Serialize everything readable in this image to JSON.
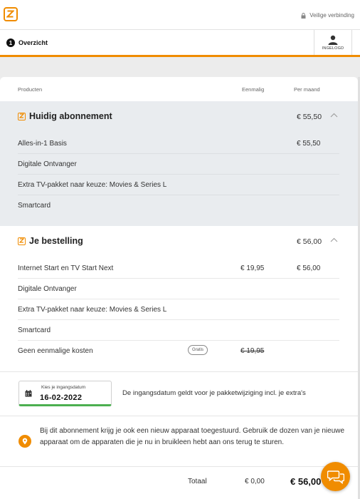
{
  "header": {
    "secure_label": "Veilige verbinding",
    "step_number": "1",
    "step_label": "Overzicht",
    "login_label": "INGELOGD"
  },
  "columns": {
    "products": "Producten",
    "once": "Eenmalig",
    "monthly": "Per maand"
  },
  "current": {
    "title": "Huidig abonnement",
    "price": "€ 55,50",
    "items": [
      {
        "name": "Alles-in-1 Basis",
        "once": "",
        "month": "€ 55,50"
      },
      {
        "name": "Digitale Ontvanger",
        "once": "",
        "month": ""
      },
      {
        "name": "Extra TV-pakket naar keuze: Movies & Series L",
        "once": "",
        "month": ""
      },
      {
        "name": "Smartcard",
        "once": "",
        "month": ""
      }
    ]
  },
  "order": {
    "title": "Je bestelling",
    "price": "€ 56,00",
    "items": [
      {
        "name": "Internet Start en TV Start Next",
        "once": "€ 19,95",
        "month": "€ 56,00"
      },
      {
        "name": "Digitale Ontvanger",
        "once": "",
        "month": ""
      },
      {
        "name": "Extra TV-pakket naar keuze: Movies & Series L",
        "once": "",
        "month": ""
      },
      {
        "name": "Smartcard",
        "once": "",
        "month": ""
      }
    ],
    "no_costs": {
      "name": "Geen eenmalige kosten",
      "badge": "Gratis",
      "struck": "€ 19,95"
    }
  },
  "start_date": {
    "label": "Kies je ingangsdatum",
    "value": "16-02-2022",
    "note": "De ingangsdatum geldt voor je pakketwijziging incl. je extra's"
  },
  "info": {
    "text": "Bij dit abonnement krijg je ook een nieuw apparaat toegestuurd. Gebruik de dozen van je nieuwe apparaat om de apparaten die je nu in bruikleen hebt aan ons terug te sturen."
  },
  "total": {
    "label": "Totaal",
    "once": "€ 0,00",
    "month": "€ 56,00"
  },
  "colors": {
    "accent": "#f08c00",
    "date_underline": "#4caf50",
    "section_bg": "#e9ecef"
  }
}
